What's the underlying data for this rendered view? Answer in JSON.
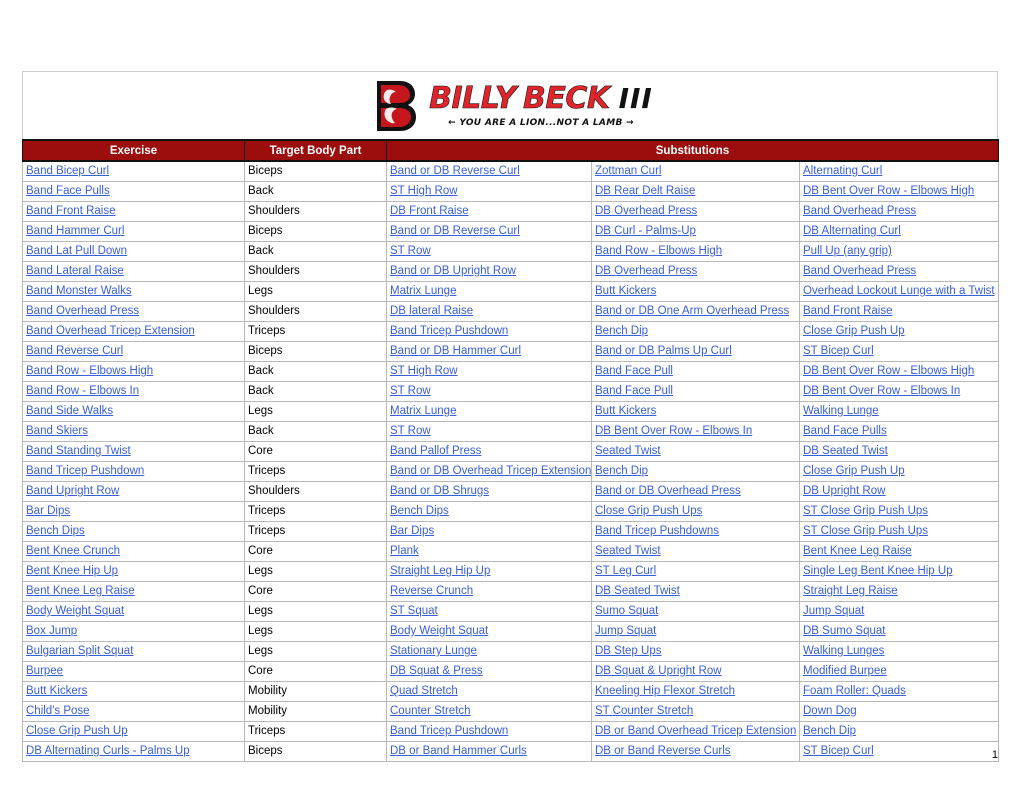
{
  "logo": {
    "brand_first": "BILLY",
    "brand_second": "BECK",
    "brand_suffix": "III",
    "tagline": "← YOU ARE A LION...NOT A LAMB →",
    "mark_letter": "B",
    "accent_color": "#e0242b",
    "dark_color": "#111111"
  },
  "table": {
    "header_bg": "#9c0d0d",
    "link_color": "#3b5fd6",
    "columns": [
      {
        "key": "exercise",
        "label": "Exercise"
      },
      {
        "key": "target",
        "label": "Target Body Part"
      },
      {
        "key": "subs",
        "label": "Substitutions"
      }
    ],
    "rows": [
      {
        "exercise": "Band Bicep Curl",
        "target": "Biceps",
        "subs": [
          "Band or DB Reverse Curl",
          "Zottman Curl",
          "Alternating Curl"
        ]
      },
      {
        "exercise": "Band Face Pulls",
        "target": "Back",
        "subs": [
          "ST High Row",
          "DB Rear Delt Raise",
          "DB Bent Over Row - Elbows High"
        ]
      },
      {
        "exercise": "Band Front Raise",
        "target": "Shoulders",
        "subs": [
          "DB Front Raise",
          "DB Overhead Press",
          "Band Overhead Press"
        ]
      },
      {
        "exercise": "Band Hammer Curl",
        "target": "Biceps",
        "subs": [
          "Band or DB Reverse Curl",
          "DB Curl - Palms-Up",
          "DB Alternating Curl"
        ]
      },
      {
        "exercise": "Band Lat Pull Down",
        "target": "Back",
        "subs": [
          "ST Row",
          "Band Row - Elbows High",
          "Pull Up (any grip)"
        ]
      },
      {
        "exercise": "Band Lateral Raise ",
        "target": "Shoulders",
        "subs": [
          "Band or DB Upright Row",
          "DB Overhead Press",
          "Band Overhead Press"
        ]
      },
      {
        "exercise": "Band Monster Walks",
        "target": "Legs",
        "subs": [
          "Matrix Lunge",
          "Butt Kickers",
          "Overhead Lockout Lunge with a Twist"
        ]
      },
      {
        "exercise": "Band Overhead Press",
        "target": "Shoulders",
        "subs": [
          "DB lateral Raise",
          "Band or DB One Arm Overhead Press",
          "Band Front Raise"
        ]
      },
      {
        "exercise": "Band Overhead Tricep Extension",
        "target": "Triceps",
        "subs": [
          "Band Tricep Pushdown",
          "Bench Dip",
          "Close Grip Push Up"
        ]
      },
      {
        "exercise": "Band Reverse Curl",
        "target": "Biceps",
        "subs": [
          "Band or DB Hammer Curl",
          "Band or DB Palms Up Curl",
          "ST Bicep Curl"
        ]
      },
      {
        "exercise": "Band Row - Elbows High",
        "target": "Back",
        "subs": [
          "ST High Row",
          "Band Face Pull",
          "DB Bent Over Row - Elbows High"
        ]
      },
      {
        "exercise": "Band Row - Elbows In",
        "target": "Back",
        "subs": [
          "ST Row",
          "Band Face Pull",
          "DB Bent Over Row - Elbows In"
        ]
      },
      {
        "exercise": "Band Side Walks",
        "target": "Legs",
        "subs": [
          "Matrix Lunge",
          "Butt Kickers",
          "Walking Lunge"
        ]
      },
      {
        "exercise": "Band Skiers",
        "target": "Back",
        "subs": [
          "ST Row",
          "DB Bent Over Row - Elbows In",
          "Band Face Pulls"
        ]
      },
      {
        "exercise": "Band Standing Twist",
        "target": "Core",
        "subs": [
          "Band Pallof Press",
          "Seated Twist",
          "DB Seated Twist"
        ]
      },
      {
        "exercise": "Band Tricep Pushdown",
        "target": "Triceps",
        "subs": [
          "Band or DB Overhead Tricep Extension",
          "Bench Dip",
          "Close Grip Push Up"
        ]
      },
      {
        "exercise": "Band Upright Row",
        "target": "Shoulders",
        "subs": [
          "Band or DB Shrugs",
          "Band or DB Overhead Press",
          "DB Upright Row"
        ]
      },
      {
        "exercise": "Bar Dips",
        "target": "Triceps",
        "subs": [
          "Bench Dips",
          "Close Grip Push Ups",
          "ST Close Grip Push Ups"
        ]
      },
      {
        "exercise": "Bench Dips",
        "target": "Triceps",
        "subs": [
          "Bar Dips",
          "Band Tricep Pushdowns",
          "ST Close Grip Push Ups"
        ]
      },
      {
        "exercise": "Bent Knee Crunch",
        "target": "Core",
        "subs": [
          "Plank",
          "Seated Twist",
          "Bent Knee Leg Raise"
        ]
      },
      {
        "exercise": "Bent Knee Hip Up",
        "target": "Legs",
        "subs": [
          "Straight Leg Hip Up",
          "ST Leg Curl",
          "Single Leg Bent Knee Hip Up"
        ]
      },
      {
        "exercise": "Bent Knee Leg Raise",
        "target": "Core",
        "subs": [
          "Reverse Crunch",
          "DB Seated Twist",
          "Straight Leg Raise"
        ]
      },
      {
        "exercise": "Body Weight Squat",
        "target": "Legs",
        "subs": [
          "ST Squat",
          "Sumo Squat",
          "Jump Squat"
        ]
      },
      {
        "exercise": "Box Jump",
        "target": "Legs",
        "subs": [
          "Body Weight Squat",
          "Jump Squat",
          "DB Sumo Squat"
        ]
      },
      {
        "exercise": "Bulgarian Split Squat",
        "target": "Legs",
        "subs": [
          "Stationary Lunge",
          "DB Step Ups",
          "Walking Lunges"
        ]
      },
      {
        "exercise": "Burpee",
        "target": "Core",
        "subs": [
          "DB Squat & Press",
          "DB Squat & Upright Row",
          "Modified Burpee"
        ]
      },
      {
        "exercise": "Butt Kickers",
        "target": "Mobility",
        "subs": [
          "Quad Stretch",
          "Kneeling Hip Flexor Stretch",
          "Foam Roller: Quads"
        ]
      },
      {
        "exercise": "Child's Pose",
        "target": "Mobility",
        "subs": [
          "Counter Stretch",
          "ST Counter Stretch",
          "Down Dog"
        ]
      },
      {
        "exercise": "Close Grip Push Up",
        "target": "Triceps",
        "subs": [
          "Band Tricep Pushdown",
          "DB or Band Overhead Tricep Extension",
          "Bench Dip"
        ]
      },
      {
        "exercise": "DB Alternating Curls - Palms Up",
        "target": "Biceps",
        "subs": [
          "DB or Band Hammer Curls",
          "DB or Band Reverse Curls",
          "ST Bicep Curl"
        ]
      }
    ]
  },
  "footer": {
    "page_number": "1"
  }
}
